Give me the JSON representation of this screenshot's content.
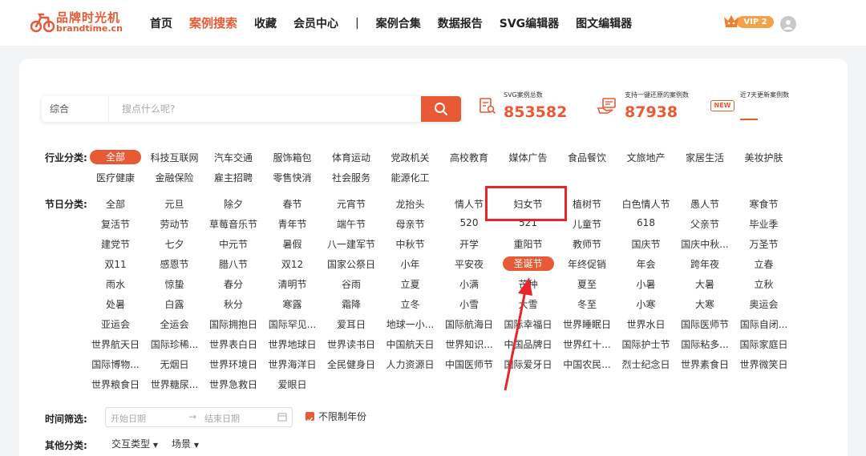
{
  "brand": {
    "name_cn": "品牌时光机",
    "name_en": "brandtime.cn",
    "accent": "#e85a35"
  },
  "nav": [
    "首页",
    "案例搜索",
    "收藏",
    "会员中心",
    "|",
    "案例合集",
    "数据报告",
    "SVG编辑器",
    "图文编辑器"
  ],
  "vip_label": "VIP 2",
  "search": {
    "type_label": "综合",
    "placeholder": "搜点什么呢?"
  },
  "stats": [
    {
      "label": "SVG案例总数",
      "value": "853582"
    },
    {
      "label": "支持一键还原的案例数",
      "value": "87938"
    },
    {
      "label": "近7天更新案例数",
      "value": "",
      "icon_text": "NEW"
    }
  ],
  "industry": {
    "label": "行业分类:",
    "items": [
      "全部",
      "科技互联网",
      "汽车交通",
      "服饰箱包",
      "体育运动",
      "党政机关",
      "高校教育",
      "媒体广告",
      "食品餐饮",
      "文旅地产",
      "家居生活",
      "美妆护肤",
      "医疗健康",
      "金融保险",
      "雇主招聘",
      "零售快消",
      "社会服务",
      "能源化工"
    ],
    "selected": "全部"
  },
  "festival": {
    "label": "节日分类:",
    "items": [
      "全部",
      "元旦",
      "除夕",
      "春节",
      "元宵节",
      "龙抬头",
      "情人节",
      "妇女节",
      "植树节",
      "白色情人节",
      "愚人节",
      "寒食节",
      "复活节",
      "劳动节",
      "草莓音乐节",
      "青年节",
      "端午节",
      "母亲节",
      "520",
      "521",
      "儿童节",
      "618",
      "父亲节",
      "毕业季",
      "建党节",
      "七夕",
      "中元节",
      "暑假",
      "八一建军节",
      "中秋节",
      "开学",
      "重阳节",
      "教师节",
      "国庆节",
      "国庆中秋...",
      "万圣节",
      "双11",
      "感恩节",
      "腊八节",
      "双12",
      "国家公祭日",
      "小年",
      "平安夜",
      "圣诞节",
      "年终促销",
      "年会",
      "跨年夜",
      "立春",
      "雨水",
      "惊蛰",
      "春分",
      "清明节",
      "谷雨",
      "立夏",
      "小满",
      "芒种",
      "夏至",
      "小暑",
      "大暑",
      "立秋",
      "处暑",
      "白露",
      "秋分",
      "寒露",
      "霜降",
      "立冬",
      "小雪",
      "大雪",
      "冬至",
      "小寒",
      "大寒",
      "奥运会",
      "亚运会",
      "全运会",
      "国际拥抱日",
      "国际罕见...",
      "爱耳日",
      "地球一小...",
      "国际航海日",
      "国际幸福日",
      "世界睡眠日",
      "世界水日",
      "国际医师节",
      "国际自闭...",
      "世界航天日",
      "国际珍稀...",
      "世界表白日",
      "世界地球日",
      "世界读书日",
      "中国航天日",
      "世界知识...",
      "中国品牌日",
      "世界红十...",
      "国际护士节",
      "国际粘多...",
      "国际家庭日",
      "国际博物...",
      "无烟日",
      "世界环境日",
      "世界海洋日",
      "全民健身日",
      "人力资源日",
      "中国医师节",
      "国际爱牙日",
      "中国农民...",
      "烈士纪念日",
      "世界素食日",
      "世界微笑日",
      "世界粮食日",
      "世界糖尿...",
      "世界急救日",
      "爱眼日"
    ],
    "selected": "圣诞节"
  },
  "time": {
    "label": "时间筛选:",
    "start_placeholder": "开始日期",
    "end_placeholder": "结束日期",
    "unlimited_label": "不限制年份",
    "unlimited_checked": true
  },
  "other": {
    "label": "其他分类:",
    "dropdowns": [
      "交互类型",
      "场景"
    ]
  }
}
